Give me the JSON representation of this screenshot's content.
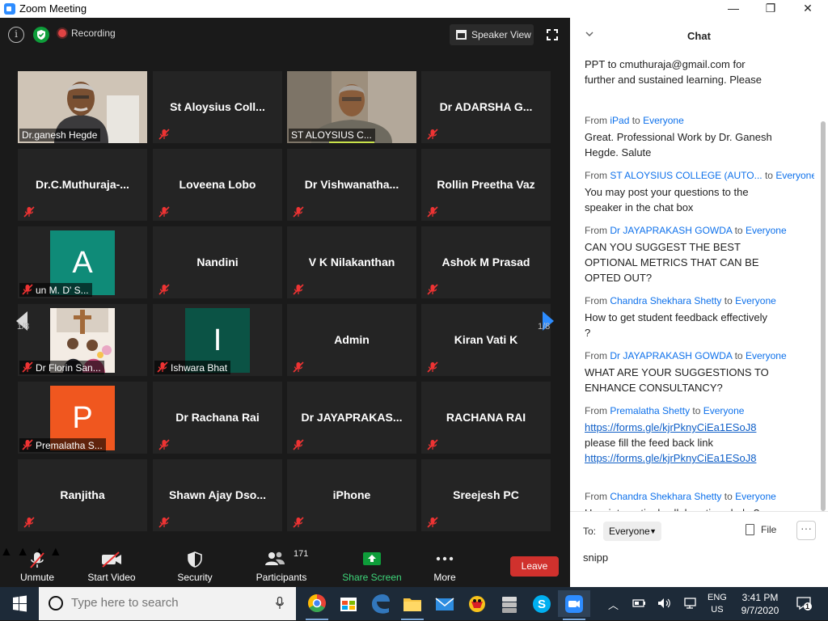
{
  "window": {
    "title": "Zoom Meeting",
    "controls": [
      "—",
      "❐",
      "✕"
    ]
  },
  "topbar": {
    "info": "i",
    "recording_label": "Recording",
    "speaker_view_label": "Speaker View"
  },
  "pager": {
    "left": "1/8",
    "right": "1/8"
  },
  "tiles": [
    {
      "name": "Dr.ganesh Hegde",
      "kind": "video"
    },
    {
      "name": "St  Aloysius Coll..."
    },
    {
      "name": "ST ALOYSIUS C...",
      "kind": "video"
    },
    {
      "name": "Dr ADARSHA G..."
    },
    {
      "name": "Dr.C.Muthuraja-..."
    },
    {
      "name": "Loveena Lobo"
    },
    {
      "name": "Dr  Vishwanatha..."
    },
    {
      "name": "Rollin Preetha Vaz"
    },
    {
      "name": "un M. D' S...",
      "avatar": "A",
      "avatar_color": "#0f8b78"
    },
    {
      "name": "Nandini"
    },
    {
      "name": "V K Nilakanthan"
    },
    {
      "name": "Ashok M Prasad"
    },
    {
      "name": "Dr Florin San...",
      "kind": "photo"
    },
    {
      "name": "Ishwara Bhat",
      "avatar": "I",
      "avatar_color": "#0b5345"
    },
    {
      "name": "Admin"
    },
    {
      "name": "Kiran Vati K"
    },
    {
      "name": "Premalatha S...",
      "avatar": "P",
      "avatar_color": "#f0571f"
    },
    {
      "name": "Dr Rachana Rai"
    },
    {
      "name": "Dr  JAYAPRAKAS..."
    },
    {
      "name": "RACHANA RAI"
    },
    {
      "name": "Ranjitha"
    },
    {
      "name": "Shawn  Ajay  Dso..."
    },
    {
      "name": "iPhone"
    },
    {
      "name": "Sreejesh PC"
    }
  ],
  "toolbar": {
    "unmute": "Unmute",
    "start_video": "Start Video",
    "security": "Security",
    "participants": "Participants",
    "participants_count": "171",
    "share_screen": "Share Screen",
    "more": "More",
    "leave": "Leave"
  },
  "chat": {
    "title": "Chat",
    "messages": [
      {
        "from": "",
        "to": "",
        "lines": [
          "PPT to cmuthuraja@gmail.com for",
          "further and sustained learning. Please"
        ]
      },
      {
        "from": "iPad",
        "to": "Everyone",
        "lines": [
          "Great. Professional Work by Dr. Ganesh",
          "Hegde. Salute"
        ]
      },
      {
        "from": "ST ALOYSIUS COLLEGE (AUTO...",
        "to": "Everyone",
        "lines": [
          "You may post your questions to the",
          "speaker in the chat box"
        ]
      },
      {
        "from": "Dr JAYAPRAKASH GOWDA",
        "to": "Everyone",
        "lines": [
          "CAN YOU SUGGEST  THE BEST",
          "OPTIONAL METRICS THAT CAN BE",
          "OPTED OUT?"
        ]
      },
      {
        "from": "Chandra Shekhara Shetty",
        "to": "Everyone",
        "lines": [
          "How to get student feedback effectively",
          "?"
        ]
      },
      {
        "from": "Dr JAYAPRAKASH GOWDA",
        "to": "Everyone",
        "lines": [
          "WHAT ARE YOUR SUGGESTIONS TO",
          "ENHANCE CONSULTANCY?"
        ]
      },
      {
        "from": "Premalatha Shetty",
        "to": "Everyone",
        "lines": [
          "https://forms.gle/kjrPknyCiEa1ESoJ8",
          "please fill the feed back link",
          "https://forms.gle/kjrPknyCiEa1ESoJ8"
        ]
      },
      {
        "from": "Chandra Shekhara Shetty",
        "to": "Everyone",
        "lines": [
          "How internationl collaborations help ?"
        ]
      }
    ],
    "from_word": "From",
    "to_word": "to",
    "to_label": "To:",
    "recipient": "Everyone",
    "file_label": "File",
    "more_label": "···",
    "draft": "snipp"
  },
  "taskbar": {
    "search_placeholder": "Type here to search",
    "apps": [
      "chrome-icon",
      "store-icon",
      "edge-icon",
      "file-explorer-icon",
      "mail-icon",
      "game-icon",
      "storage-icon",
      "skype-icon",
      "zoom-icon"
    ],
    "lang_line1": "ENG",
    "lang_line2": "US",
    "time": "3:41 PM",
    "date": "9/7/2020",
    "notifications": "1"
  }
}
